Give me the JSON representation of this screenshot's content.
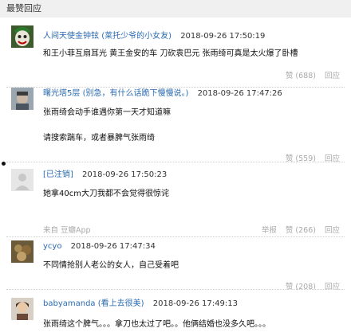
{
  "section": {
    "title": "最赞回应"
  },
  "comments": [
    {
      "user": "人间天使金钟铉",
      "user_note": "(莱托少爷的小女友)",
      "time": "2018-09-26 17:50:19",
      "lines": [
        "和王小菲互扇耳光 黄王金安的车 刀砍袁巴元 张雨绮可真是太火爆了卧槽"
      ],
      "likes": "赞 (688)",
      "reply": "回应"
    },
    {
      "user": "曙光塔5层",
      "user_note": "(别急，有什么话跪下慢慢说。)",
      "time": "2018-09-26 17:47:26",
      "lines": [
        "张雨绮会动手谁遇你第一天才知道嘛",
        "请搜索踹车，或者暴脾气张雨绮"
      ],
      "likes": "赞 (559)",
      "reply": "回应"
    },
    {
      "user": "[已注销]",
      "user_note": "",
      "time": "2018-09-26 17:50:23",
      "lines": [
        "她拿40cm大刀我都不会觉得很惊诧"
      ],
      "source": "来自 豆瓣App",
      "report": "举报",
      "likes": "赞 (266)",
      "reply": "回应"
    },
    {
      "user": "ycyo",
      "user_note": "",
      "time": "2018-09-26 17:47:34",
      "lines": [
        "不同情抢别人老公的女人，自己受着吧"
      ],
      "likes": "赞 (208)",
      "reply": "回应"
    },
    {
      "user": "babyamanda",
      "user_note": "(看上去很美)",
      "time": "2018-09-26 17:49:13",
      "lines": [
        "张雨绮这个脾气。。。拿刀也太过了吧。。他俩结婚也没多久吧。。。"
      ]
    }
  ]
}
